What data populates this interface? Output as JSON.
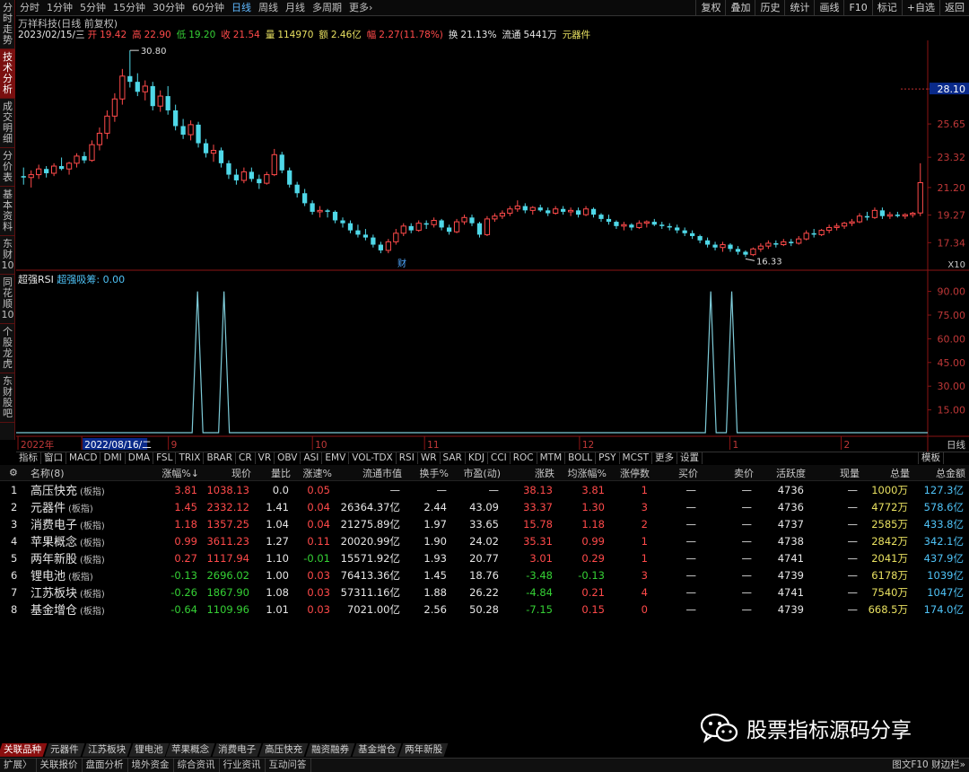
{
  "left_tabs": [
    "分时走势",
    "技术分析",
    "成交明细",
    "分价表",
    "基本资料",
    "东财10",
    "同花顺10",
    "个股龙虎",
    "东财股吧"
  ],
  "left_active": 1,
  "periods": [
    "分时",
    "1分钟",
    "5分钟",
    "15分钟",
    "30分钟",
    "60分钟",
    "日线",
    "周线",
    "月线",
    "多周期",
    "更多›"
  ],
  "period_active": 6,
  "toolbar_right": [
    "复权",
    "叠加",
    "历史",
    "统计",
    "画线",
    "F10",
    "标记",
    "+自选",
    "返回"
  ],
  "stock_title": "万祥科技(日线 前复权)",
  "quote": {
    "date": "2023/02/15/三",
    "open_label": "开",
    "open": "19.42",
    "high_label": "高",
    "high": "22.90",
    "low_label": "低",
    "low": "19.20",
    "close_label": "收",
    "close": "21.54",
    "vol_label": "量",
    "vol": "114970",
    "amt_label": "额",
    "amt": "2.46亿",
    "chg_label": "幅",
    "chg": "2.27(11.78%)",
    "turn_label": "换",
    "turn": "21.13%",
    "float_label": "流通",
    "float": "5441万",
    "sector": "元器件"
  },
  "chart_data": [
    {
      "type": "candlestick",
      "title": "",
      "y_ticks": [
        "28.10",
        "25.65",
        "23.32",
        "21.20",
        "19.27",
        "17.34"
      ],
      "ylim": [
        15.6,
        31.5
      ],
      "price_label": "28.10",
      "high_annotation": "30.80",
      "low_annotation": "16.33",
      "marker": "财",
      "multiplier": "X10",
      "x_ticks": [
        "2022年",
        "2022/08/16/二",
        "9",
        "10",
        "11",
        "12",
        "1",
        "2"
      ],
      "candles": [
        [
          22.0,
          22.6,
          21.4,
          21.9
        ],
        [
          21.9,
          22.4,
          21.2,
          22.1
        ],
        [
          22.1,
          22.8,
          21.8,
          22.5
        ],
        [
          22.5,
          22.7,
          21.9,
          22.2
        ],
        [
          22.2,
          22.9,
          22.0,
          22.7
        ],
        [
          22.7,
          23.3,
          22.4,
          22.5
        ],
        [
          22.5,
          23.0,
          22.1,
          22.9
        ],
        [
          22.9,
          23.6,
          22.6,
          23.4
        ],
        [
          23.4,
          23.7,
          22.9,
          23.1
        ],
        [
          23.1,
          24.5,
          23.0,
          24.2
        ],
        [
          24.2,
          25.4,
          23.8,
          25.0
        ],
        [
          25.0,
          26.6,
          24.6,
          26.2
        ],
        [
          26.2,
          27.8,
          25.8,
          27.4
        ],
        [
          27.4,
          29.5,
          27.0,
          29.0
        ],
        [
          29.0,
          30.8,
          28.2,
          28.6
        ],
        [
          28.6,
          29.2,
          27.6,
          27.9
        ],
        [
          27.9,
          28.7,
          27.3,
          28.3
        ],
        [
          28.3,
          28.6,
          26.6,
          26.9
        ],
        [
          26.9,
          28.0,
          26.5,
          27.6
        ],
        [
          27.6,
          28.3,
          26.3,
          26.6
        ],
        [
          26.6,
          27.0,
          25.2,
          25.5
        ],
        [
          25.5,
          26.0,
          24.6,
          24.9
        ],
        [
          24.9,
          25.9,
          24.5,
          25.6
        ],
        [
          25.6,
          25.8,
          24.0,
          24.3
        ],
        [
          24.3,
          24.6,
          23.3,
          23.6
        ],
        [
          23.6,
          24.2,
          23.0,
          23.8
        ],
        [
          23.8,
          24.0,
          22.6,
          22.9
        ],
        [
          22.9,
          23.1,
          21.8,
          22.1
        ],
        [
          22.1,
          22.5,
          21.4,
          21.7
        ],
        [
          21.7,
          22.6,
          21.5,
          22.3
        ],
        [
          22.3,
          22.6,
          21.6,
          21.8
        ],
        [
          21.8,
          22.1,
          21.1,
          21.5
        ],
        [
          21.5,
          22.3,
          21.4,
          22.1
        ],
        [
          22.1,
          23.9,
          22.0,
          23.5
        ],
        [
          23.5,
          23.7,
          22.2,
          22.4
        ],
        [
          22.4,
          22.6,
          21.2,
          21.4
        ],
        [
          21.4,
          21.6,
          20.5,
          20.8
        ],
        [
          20.8,
          21.1,
          19.9,
          20.1
        ],
        [
          20.1,
          20.3,
          19.3,
          19.5
        ],
        [
          19.5,
          19.9,
          19.1,
          19.6
        ],
        [
          19.6,
          19.7,
          19.1,
          19.5
        ],
        [
          19.5,
          19.6,
          18.7,
          18.9
        ],
        [
          18.9,
          19.1,
          18.4,
          18.7
        ],
        [
          18.7,
          18.9,
          18.0,
          18.2
        ],
        [
          18.2,
          18.6,
          17.7,
          17.9
        ],
        [
          17.9,
          18.3,
          17.5,
          17.7
        ],
        [
          17.7,
          17.9,
          17.0,
          17.2
        ],
        [
          17.2,
          17.4,
          16.6,
          16.8
        ],
        [
          16.8,
          17.6,
          16.6,
          17.4
        ],
        [
          17.4,
          18.3,
          17.2,
          18.0
        ],
        [
          18.0,
          18.7,
          17.8,
          18.5
        ],
        [
          18.5,
          18.7,
          18.0,
          18.2
        ],
        [
          18.2,
          18.9,
          18.1,
          18.7
        ],
        [
          18.7,
          18.9,
          18.3,
          18.6
        ],
        [
          18.6,
          19.1,
          18.4,
          18.9
        ],
        [
          18.9,
          19.0,
          18.2,
          18.4
        ],
        [
          18.4,
          18.6,
          17.9,
          18.1
        ],
        [
          18.1,
          19.0,
          18.0,
          18.8
        ],
        [
          18.8,
          19.3,
          18.6,
          19.1
        ],
        [
          19.1,
          19.3,
          18.5,
          18.7
        ],
        [
          18.7,
          18.8,
          17.7,
          17.9
        ],
        [
          17.9,
          19.2,
          17.8,
          19.0
        ],
        [
          19.0,
          19.4,
          18.8,
          19.2
        ],
        [
          19.2,
          19.6,
          19.0,
          19.4
        ],
        [
          19.4,
          19.9,
          19.2,
          19.7
        ],
        [
          19.7,
          20.3,
          19.5,
          19.9
        ],
        [
          19.9,
          20.1,
          19.4,
          19.6
        ],
        [
          19.6,
          19.9,
          19.3,
          19.8
        ],
        [
          19.8,
          20.0,
          19.5,
          19.6
        ],
        [
          19.6,
          19.8,
          19.2,
          19.4
        ],
        [
          19.4,
          19.9,
          19.3,
          19.7
        ],
        [
          19.7,
          19.9,
          19.3,
          19.5
        ],
        [
          19.5,
          19.8,
          19.2,
          19.6
        ],
        [
          19.6,
          19.8,
          19.1,
          19.3
        ],
        [
          19.3,
          19.9,
          19.2,
          19.7
        ],
        [
          19.7,
          19.8,
          19.1,
          19.3
        ],
        [
          19.3,
          19.4,
          18.8,
          19.0
        ],
        [
          19.0,
          19.3,
          18.6,
          18.8
        ],
        [
          18.8,
          18.9,
          18.3,
          18.5
        ],
        [
          18.5,
          18.8,
          18.2,
          18.6
        ],
        [
          18.6,
          18.7,
          18.2,
          18.4
        ],
        [
          18.4,
          18.9,
          18.3,
          18.7
        ],
        [
          18.7,
          18.9,
          18.4,
          18.8
        ],
        [
          18.8,
          19.0,
          18.5,
          18.6
        ],
        [
          18.6,
          18.8,
          18.3,
          18.5
        ],
        [
          18.5,
          18.7,
          18.2,
          18.4
        ],
        [
          18.4,
          18.6,
          18.0,
          18.2
        ],
        [
          18.2,
          18.4,
          17.8,
          18.0
        ],
        [
          18.0,
          18.2,
          17.6,
          17.8
        ],
        [
          17.8,
          17.9,
          17.3,
          17.5
        ],
        [
          17.5,
          17.7,
          17.0,
          17.2
        ],
        [
          17.2,
          17.4,
          16.8,
          17.0
        ],
        [
          17.0,
          17.4,
          16.7,
          17.2
        ],
        [
          17.2,
          17.3,
          16.7,
          16.9
        ],
        [
          16.9,
          17.1,
          16.5,
          16.7
        ],
        [
          16.7,
          16.8,
          16.33,
          16.5
        ],
        [
          16.5,
          17.0,
          16.4,
          16.9
        ],
        [
          16.9,
          17.3,
          16.7,
          17.1
        ],
        [
          17.1,
          17.5,
          16.9,
          17.3
        ],
        [
          17.3,
          17.5,
          17.0,
          17.2
        ],
        [
          17.2,
          17.6,
          17.1,
          17.4
        ],
        [
          17.4,
          17.6,
          17.1,
          17.3
        ],
        [
          17.3,
          17.8,
          17.2,
          17.6
        ],
        [
          17.6,
          18.2,
          17.5,
          18.0
        ],
        [
          18.0,
          18.3,
          17.7,
          17.9
        ],
        [
          17.9,
          18.3,
          17.8,
          18.2
        ],
        [
          18.2,
          18.6,
          18.0,
          18.4
        ],
        [
          18.4,
          18.7,
          18.2,
          18.5
        ],
        [
          18.5,
          18.8,
          18.3,
          18.7
        ],
        [
          18.7,
          19.0,
          18.5,
          18.8
        ],
        [
          18.8,
          19.4,
          18.7,
          19.2
        ],
        [
          19.2,
          19.5,
          18.9,
          19.1
        ],
        [
          19.1,
          19.8,
          19.0,
          19.6
        ],
        [
          19.6,
          19.8,
          19.0,
          19.2
        ],
        [
          19.2,
          19.5,
          19.0,
          19.3
        ],
        [
          19.3,
          19.5,
          19.1,
          19.2
        ],
        [
          19.2,
          19.4,
          19.0,
          19.3
        ],
        [
          19.3,
          19.5,
          19.1,
          19.4
        ],
        [
          19.42,
          22.9,
          19.2,
          21.54
        ]
      ]
    },
    {
      "type": "line",
      "title": "超强RSI",
      "series_label": "超强吸筹",
      "series_value": "0.00",
      "y_ticks": [
        "90.00",
        "75.00",
        "60.00",
        "45.00",
        "30.00",
        "15.00"
      ],
      "ylim": [
        0,
        100
      ],
      "spikes": [
        {
          "x": 0.199,
          "value": 90
        },
        {
          "x": 0.228,
          "value": 90
        },
        {
          "x": 0.762,
          "value": 90
        },
        {
          "x": 0.785,
          "value": 90
        }
      ]
    }
  ],
  "ind_tabs": [
    "指标",
    "窗口",
    "MACD",
    "DMI",
    "DMA",
    "FSL",
    "TRIX",
    "BRAR",
    "CR",
    "VR",
    "OBV",
    "ASI",
    "EMV",
    "VOL-TDX",
    "RSI",
    "WR",
    "SAR",
    "KDJ",
    "CCI",
    "ROC",
    "MTM",
    "BOLL",
    "PSY",
    "MCST",
    "更多",
    "设置"
  ],
  "ind_tab_right": "模板",
  "table": {
    "headers": [
      "",
      "名称(8)",
      "涨幅%↓",
      "现价",
      "量比",
      "涨速%",
      "流通市值",
      "换手%",
      "市盈(动)",
      "涨跌",
      "均涨幅%",
      "涨停数",
      "买价",
      "卖价",
      "活跃度",
      "现量",
      "总量",
      "总金额"
    ],
    "tag": "(板指)",
    "rows": [
      [
        "1",
        "高压快充",
        "3.81",
        "1038.13",
        "0.0",
        "0.05",
        "—",
        "—",
        "—",
        "38.13",
        "3.81",
        "1",
        "—",
        "—",
        "4736",
        "—",
        "1000万",
        "127.3亿"
      ],
      [
        "2",
        "元器件",
        "1.45",
        "2332.12",
        "1.41",
        "0.04",
        "26364.37亿",
        "2.44",
        "43.09",
        "33.37",
        "1.30",
        "3",
        "—",
        "—",
        "4736",
        "—",
        "4772万",
        "578.6亿"
      ],
      [
        "3",
        "消费电子",
        "1.18",
        "1357.25",
        "1.04",
        "0.04",
        "21275.89亿",
        "1.97",
        "33.65",
        "15.78",
        "1.18",
        "2",
        "—",
        "—",
        "4737",
        "—",
        "2585万",
        "433.8亿"
      ],
      [
        "4",
        "苹果概念",
        "0.99",
        "3611.23",
        "1.27",
        "0.11",
        "20020.99亿",
        "1.90",
        "24.02",
        "35.31",
        "0.99",
        "1",
        "—",
        "—",
        "4738",
        "—",
        "2842万",
        "342.1亿"
      ],
      [
        "5",
        "两年新股",
        "0.27",
        "1117.94",
        "1.10",
        "-0.01",
        "15571.92亿",
        "1.93",
        "20.77",
        "3.01",
        "0.29",
        "1",
        "—",
        "—",
        "4741",
        "—",
        "2041万",
        "437.9亿"
      ],
      [
        "6",
        "锂电池",
        "-0.13",
        "2696.02",
        "1.00",
        "0.03",
        "76413.36亿",
        "1.45",
        "18.76",
        "-3.48",
        "-0.13",
        "3",
        "—",
        "—",
        "4739",
        "—",
        "6178万",
        "1039亿"
      ],
      [
        "7",
        "江苏板块",
        "-0.26",
        "1867.90",
        "1.08",
        "0.03",
        "57311.16亿",
        "1.88",
        "26.22",
        "-4.84",
        "0.21",
        "4",
        "—",
        "—",
        "4741",
        "—",
        "7540万",
        "1047亿"
      ],
      [
        "8",
        "基金增仓",
        "-0.64",
        "1109.96",
        "1.01",
        "0.03",
        "7021.00亿",
        "2.56",
        "50.28",
        "-7.15",
        "0.15",
        "0",
        "—",
        "—",
        "4739",
        "—",
        "668.5万",
        "174.0亿"
      ]
    ]
  },
  "bottom_tabs": [
    "关联品种",
    "元器件",
    "江苏板块",
    "锂电池",
    "苹果概念",
    "消费电子",
    "高压快充",
    "融资融券",
    "基金增仓",
    "两年新股"
  ],
  "status_tabs": [
    "扩展〉",
    "关联报价",
    "盘面分析",
    "境外资金",
    "综合资讯",
    "行业资讯",
    "互动问答"
  ],
  "status_right": "图文F10 财边栏»",
  "watermark_text": "股票指标源码分享",
  "colors": {
    "up": "#ff4a4a",
    "down": "#4fd8e8",
    "rsi": "#7ecbd8",
    "axis": "#8b1414"
  }
}
